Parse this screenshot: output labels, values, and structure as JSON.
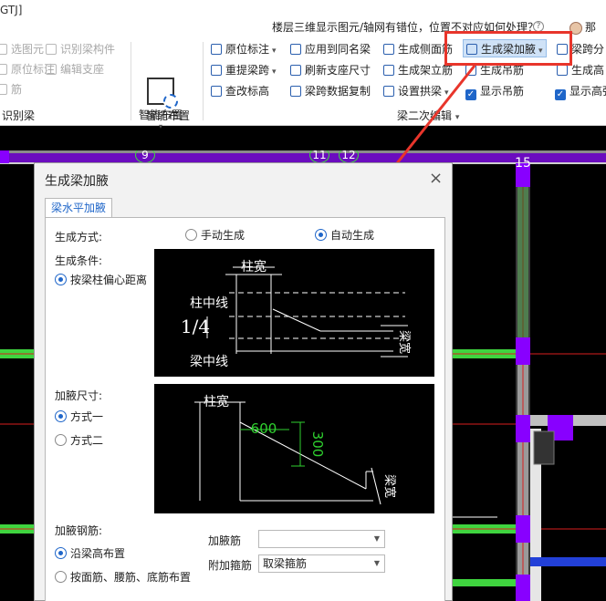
{
  "app_title": "GTJ]",
  "question": "楼层三维显示图元/轴网有错位，位置不对应如何处理？",
  "user_name": "那年",
  "ribbon": {
    "col1": [
      "选图元",
      "原位标注",
      "筋"
    ],
    "col1b": [
      "识别梁构件",
      "编辑支座"
    ],
    "col1_group": "识别梁",
    "smart_layout": "智能布置",
    "smart_group": "智能布置",
    "col3": [
      "原位标注",
      "重提梁跨",
      "查改标高"
    ],
    "col4": [
      "应用到同名梁",
      "刷新支座尺寸",
      "梁跨数据复制"
    ],
    "col5": [
      "生成侧面筋",
      "生成架立筋",
      "设置拱梁"
    ],
    "col6": [
      "生成梁加腋",
      "生成吊筋",
      "显示吊筋"
    ],
    "col7": [
      "梁跨分",
      "生成高",
      "显示高强"
    ],
    "group2": "梁二次编辑"
  },
  "axis_labels": [
    "9",
    "11",
    "12",
    "15"
  ],
  "dialog": {
    "title": "生成梁加腋",
    "tab": "梁水平加腋",
    "method_label": "生成方式:",
    "manual": "手动生成",
    "auto": "自动生成",
    "condition_label": "生成条件:",
    "condition_option": "按梁柱偏心距离",
    "size_label": "加腋尺寸:",
    "mode1": "方式一",
    "mode2": "方式二",
    "rebar_label": "加腋钢筋:",
    "rebar_opt1": "沿梁高布置",
    "rebar_opt2": "按面筋、腰筋、底筋布置",
    "haunch_rebar_label": "加腋筋",
    "haunch_rebar_value": "",
    "stirrup_label": "附加箍筋",
    "stirrup_value": "取梁箍筋",
    "diag1": {
      "col_width": "柱宽",
      "col_center": "柱中线",
      "quarter": "1/4",
      "beam_center": "梁中线",
      "beam_width": "梁宽"
    },
    "diag2": {
      "col_width": "柱宽",
      "dim_h": "600",
      "dim_v": "300",
      "beam_width": "梁宽"
    }
  }
}
